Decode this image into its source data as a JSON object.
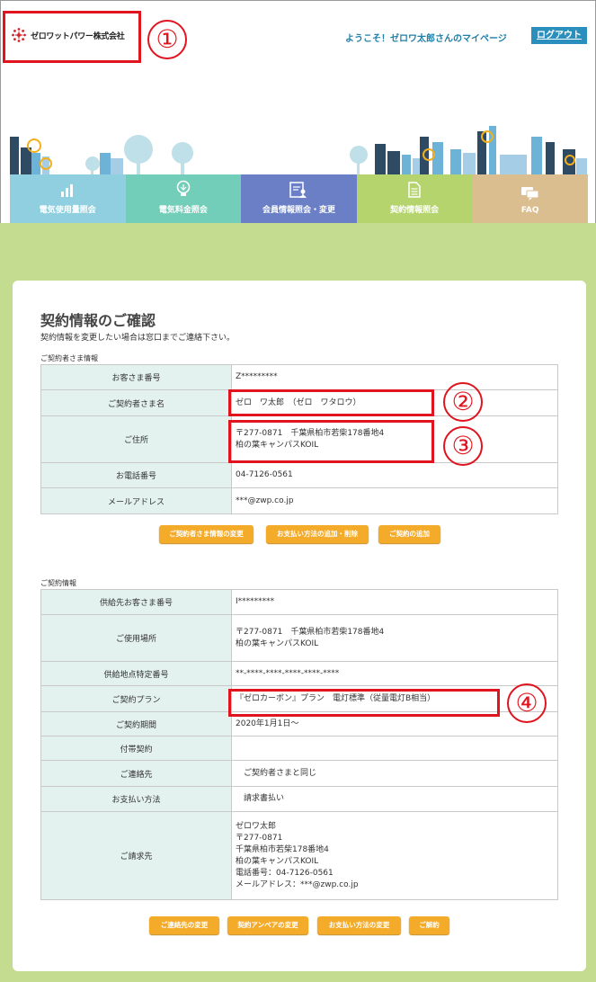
{
  "header": {
    "logo_text": "ゼロワットパワー株式会社",
    "welcome": "ようこそ！ゼロワ太郎さんのマイページ",
    "logout": "ログアウト"
  },
  "nav": [
    {
      "label": "電気使用量照会",
      "icon": "bar-chart-icon",
      "color": "#8fcfe0"
    },
    {
      "label": "電気料金照会",
      "icon": "lightbulb-icon",
      "color": "#72cdb9"
    },
    {
      "label": "会員情報照会・変更",
      "icon": "member-card-icon",
      "color": "#6a7fc6"
    },
    {
      "label": "契約情報照会",
      "icon": "document-icon",
      "color": "#b5d46e"
    },
    {
      "label": "FAQ",
      "icon": "chat-bubble-icon",
      "color": "#dbbe8f"
    }
  ],
  "page": {
    "title": "契約情報のご確認",
    "subtitle": "契約情報を変更したい場合は窓口までご連絡下さい。"
  },
  "contractor_section": {
    "title": "ご契約者さま情報",
    "rows": [
      {
        "label": "お客さま番号",
        "lines": [
          "Z*********"
        ]
      },
      {
        "label": "ご契約者さま名",
        "lines": [
          "ゼロ　ワ太郎　（ゼロ　ワタロウ）"
        ]
      },
      {
        "label": "ご住所",
        "lines": [
          "〒277-0871　千葉県柏市若柴178番地4",
          "柏の葉キャンパスKOIL"
        ]
      },
      {
        "label": "お電話番号",
        "lines": [
          "04-7126-0561"
        ]
      },
      {
        "label": "メールアドレス",
        "lines": [
          "***@zwp.co.jp"
        ]
      }
    ],
    "buttons": [
      "ご契約者さま情報の変更",
      "お支払い方法の追加・削除",
      "ご契約の追加"
    ]
  },
  "contract_section": {
    "title": "ご契約情報",
    "rows": [
      {
        "label": "供給先お客さま番号",
        "lines": [
          "I*********"
        ]
      },
      {
        "label": "ご使用場所",
        "lines": [
          "〒277-0871　千葉県柏市若柴178番地4",
          "柏の葉キャンパスKOIL"
        ]
      },
      {
        "label": "供給地点特定番号",
        "lines": [
          "**-****-****-****-****-****"
        ]
      },
      {
        "label": "ご契約プラン",
        "lines": [
          "『ゼロカーボン』プラン　電灯標準（従量電灯B相当）"
        ]
      },
      {
        "label": "ご契約期間",
        "lines": [
          "2020年1月1日～"
        ]
      },
      {
        "label": "付帯契約",
        "lines": [
          ""
        ]
      },
      {
        "label": "ご連絡先",
        "lines": [
          "　ご契約者さまと同じ"
        ]
      },
      {
        "label": "お支払い方法",
        "lines": [
          "　請求書払い"
        ]
      },
      {
        "label": "ご請求先",
        "lines": [
          "ゼロワ太郎",
          "〒277-0871",
          "千葉県柏市若柴178番地4",
          "柏の葉キャンパスKOIL",
          "電話番号：04-7126-0561",
          "メールアドレス：***@zwp.co.jp"
        ]
      }
    ],
    "buttons": [
      "ご連絡先の変更",
      "契約アンペアの変更",
      "お支払い方法の変更",
      "ご解約"
    ]
  },
  "annotations": [
    "①",
    "②",
    "③",
    "④"
  ],
  "colors": {
    "accent": "#f4ab2a",
    "highlight": "#e0141e",
    "header_cell": "#e3f1ef",
    "background": "#c3dc8f"
  }
}
